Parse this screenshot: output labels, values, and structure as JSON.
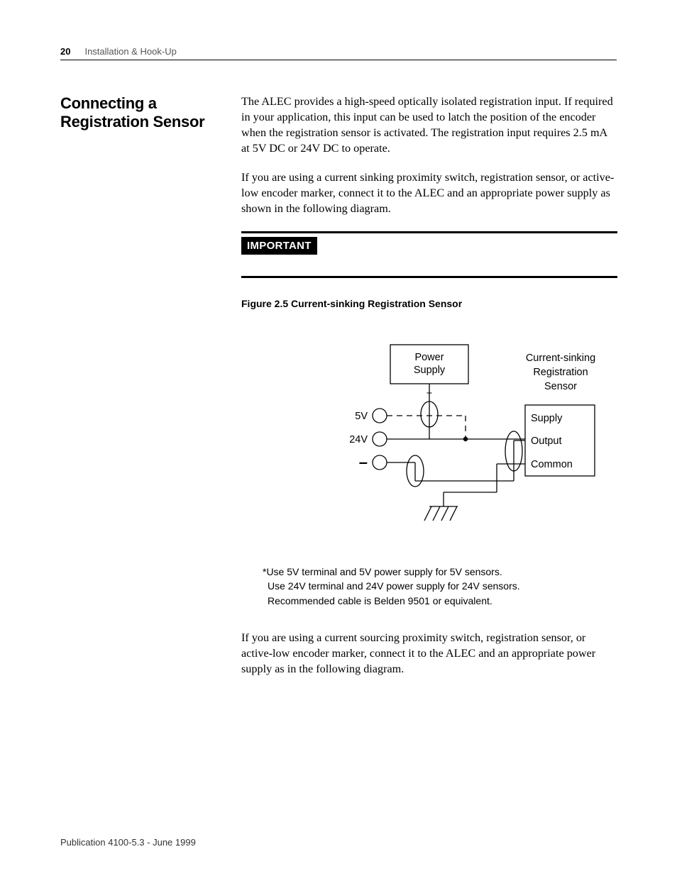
{
  "header": {
    "page_number": "20",
    "chapter_title": "Installation & Hook-Up"
  },
  "section": {
    "heading": "Connecting a Registration Sensor",
    "para1": "The ALEC provides a high-speed optically isolated registration input. If required in your application, this input can be used to latch the position of the encoder when the registration sensor is activated. The registration input requires 2.5 mA at 5V DC or 24V DC to operate.",
    "para2": "If you are using a current sinking proximity switch, registration sensor, or active-low encoder marker, connect it to the ALEC and an appropriate power supply as shown in the following diagram."
  },
  "important_label": "IMPORTANT",
  "figure": {
    "caption": "Figure 2.5 Current-sinking Registration Sensor",
    "labels": {
      "power_supply": "Power",
      "power_supply2": "Supply",
      "plus": "+",
      "sensor_title1": "Current-sinking",
      "sensor_title2": "Registration",
      "sensor_title3": "Sensor",
      "t5v": "5V",
      "t24v": "24V",
      "minus": "–",
      "supply": "Supply",
      "output": "Output",
      "common": "Common"
    }
  },
  "notes": {
    "n1": "*Use 5V terminal and 5V power supply for 5V sensors.",
    "n2": "Use 24V terminal and 24V power supply for 24V sensors.",
    "n3": "Recommended cable is Belden 9501 or equivalent."
  },
  "para3": "If you are using a current sourcing proximity switch, registration sensor, or active-low encoder marker, connect it to the ALEC and an appropriate power supply as in the following diagram.",
  "footer": "Publication 4100-5.3 - June 1999"
}
